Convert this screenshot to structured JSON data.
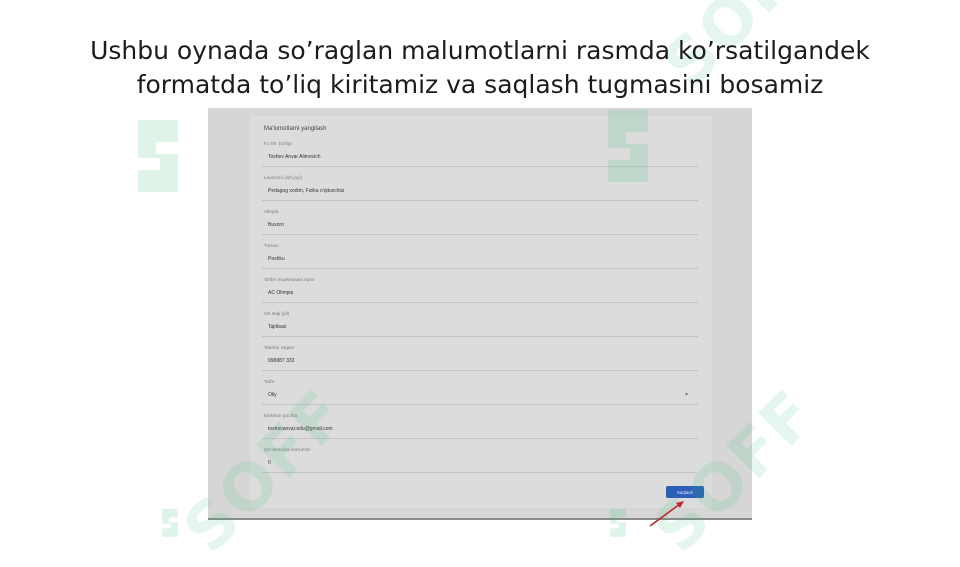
{
  "slide": {
    "title_line1": "Ushbu oynada so’raglan malumotlarni rasmda ko’rsatilgandek",
    "title_line2": "formatda to’liq kiritamiz va saqlash tugmasini bosamiz"
  },
  "watermark": {
    "text": "SOFF",
    "color": "#36c07a"
  },
  "form": {
    "heading": "Ma'lumotlarni yangilash",
    "fields": [
      {
        "label": "F.I.Sh. (to'liq)",
        "value": "Toshev Anvar Alimovich"
      },
      {
        "label": "Lavozimi (ish joyi)",
        "value": "Pedagog xodim, Fizika o'qituvchisi"
      },
      {
        "label": "Viloyat",
        "value": "Buxoro"
      },
      {
        "label": "Tuman",
        "value": "Peshku"
      },
      {
        "label": "Ta'lim muassasasi nomi",
        "value": "AC Olimpia"
      },
      {
        "label": "Ish staji (yil)",
        "value": "Tajribasi"
      },
      {
        "label": "Telefon raqam",
        "value": "998887 333"
      },
      {
        "label": "Toifa",
        "value": "Oliy",
        "type": "select"
      },
      {
        "label": "Elektron pochta",
        "value": "toshevanvar.edu@gmail.com"
      },
      {
        "label": "Qo'shimcha ma'lumot",
        "value": "0"
      }
    ],
    "save_label": "Saqlash"
  }
}
